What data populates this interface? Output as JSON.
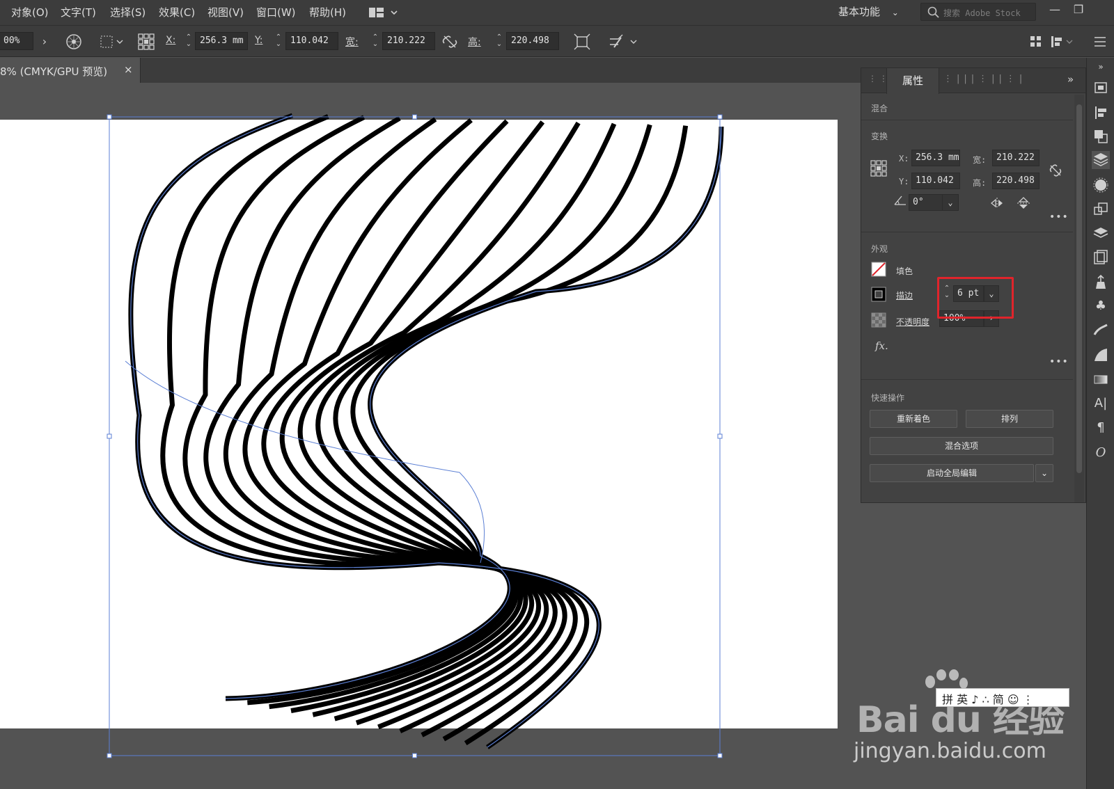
{
  "menubar": {
    "items": [
      "对象(O)",
      "文字(T)",
      "选择(S)",
      "效果(C)",
      "视图(V)",
      "窗口(W)",
      "帮助(H)"
    ],
    "workspace": "基本功能",
    "search_placeholder": "搜索 Adobe Stock"
  },
  "controlbar": {
    "zoom": "00%",
    "x_label": "X:",
    "x_value": "256.3 mm",
    "y_label": "Y:",
    "y_value": "110.042",
    "w_label": "宽:",
    "w_value": "210.222",
    "h_label": "高:",
    "h_value": "220.498"
  },
  "document": {
    "tab_title": "8% (CMYK/GPU 预览)",
    "close_glyph": "×"
  },
  "properties": {
    "tab_label": "属性",
    "section_blend": "混合",
    "section_transform": "变换",
    "x_label": "X:",
    "x_value": "256.3 mm",
    "y_label": "Y:",
    "y_value": "110.042",
    "w_label": "宽:",
    "w_value": "210.222",
    "h_label": "高:",
    "h_value": "220.498",
    "angle_value": "0°",
    "section_appearance": "外观",
    "fill_label": "填色",
    "stroke_label": "描边",
    "stroke_value": "6 pt",
    "opacity_label": "不透明度",
    "opacity_value": "100%",
    "fx_label": "fx.",
    "section_quick": "快速操作",
    "btn_recolor": "重新着色",
    "btn_arrange": "排列",
    "btn_blend_options": "混合选项",
    "btn_global_edit": "启动全局编辑"
  },
  "watermark": {
    "brand": "Bai du 经验",
    "url": "jingyan.baidu.com"
  },
  "ime": {
    "text": "拼 英 ♪ ∴ 简 ☺ ⋮"
  },
  "colors": {
    "chrome_dark": "#3c3c3c",
    "canvas": "#535353",
    "panel": "#424242",
    "highlight": "#e0242b",
    "selection": "#5b7fd4"
  }
}
